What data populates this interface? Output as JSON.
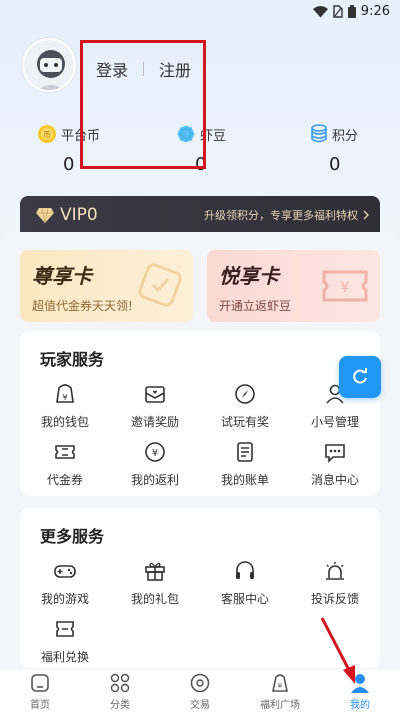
{
  "status_bar": {
    "time": "9:26"
  },
  "account": {
    "login_label": "登录",
    "register_label": "注册"
  },
  "stats": [
    {
      "label": "平台币",
      "value": "0",
      "icon": "coin-icon"
    },
    {
      "label": "虾豆",
      "value": "0",
      "icon": "gear-icon"
    },
    {
      "label": "积分",
      "value": "0",
      "icon": "points-icon"
    }
  ],
  "vip": {
    "level": "VIP0",
    "tip": "升级领积分，专享更多福利特权"
  },
  "cards": [
    {
      "title": "尊享卡",
      "subtitle": "超值代金券天天领!"
    },
    {
      "title": "悦享卡",
      "subtitle": "开通立返虾豆"
    }
  ],
  "player_services": {
    "title": "玩家服务",
    "items": [
      "我的钱包",
      "邀请奖励",
      "试玩有奖",
      "小号管理",
      "代金券",
      "我的返利",
      "我的账单",
      "消息中心"
    ]
  },
  "more_services": {
    "title": "更多服务",
    "items": [
      "我的游戏",
      "我的礼包",
      "客服中心",
      "投诉反馈",
      "福利兑换"
    ]
  },
  "tabs": [
    {
      "label": "首页",
      "active": false
    },
    {
      "label": "分类",
      "active": false
    },
    {
      "label": "交易",
      "active": false
    },
    {
      "label": "福利广场",
      "active": false
    },
    {
      "label": "我的",
      "active": true
    }
  ],
  "colors": {
    "accent": "#2196f3",
    "highlight": "#d6161e",
    "vip_bg": "#34323c"
  }
}
